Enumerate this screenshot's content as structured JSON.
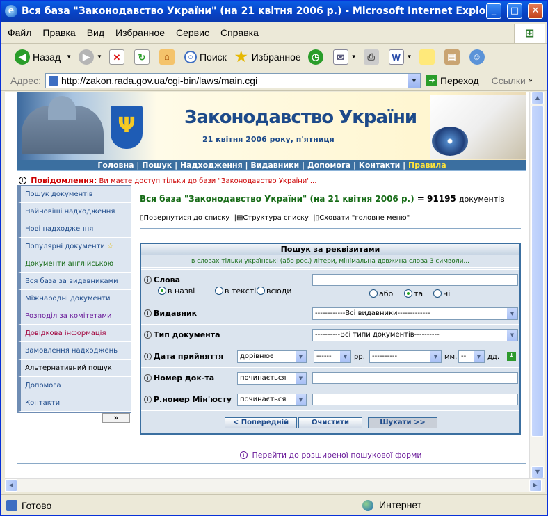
{
  "window": {
    "title": "Вся база \"Законодавство України\" (на 21 квітня 2006 р.) - Microsoft Internet Explorer"
  },
  "menu": [
    "Файл",
    "Правка",
    "Вид",
    "Избранное",
    "Сервис",
    "Справка"
  ],
  "toolbar": {
    "back": "Назад",
    "search": "Поиск",
    "favorites": "Избранное"
  },
  "address": {
    "label": "Адрес:",
    "url": "http://zakon.rada.gov.ua/cgi-bin/laws/main.cgi",
    "go": "Переход",
    "links": "Ссылки"
  },
  "banner": {
    "title": "Законодавство України",
    "date": "21 квітня 2006 року, п'ятниця"
  },
  "nav": [
    "Головна",
    "Пошук",
    "Надходження",
    "Видавники",
    "Допомога",
    "Контакти",
    "Правила"
  ],
  "message": {
    "label": "Повідомлення:",
    "text": "Ви маєте доступ тільки до бази \"Законодавство України\"..."
  },
  "sidebar": {
    "items": [
      "Пошук документів",
      "Найновіші надходження",
      "Нові надходження",
      "Популярні документи",
      "Документи англійською",
      "Вся база за видавниками",
      "Міжнародні документи",
      "Розподіл за комітетами",
      "Довідкова інформація",
      "Замовлення надходжень",
      "Альтернативний пошук",
      "Допомога",
      "Контакти"
    ],
    "more": "»"
  },
  "main": {
    "title": "Вся база \"Законодавство України\" (на 21 квітня 2006 р.)",
    "count_prefix": "=",
    "count": "91195",
    "count_suffix": "документів",
    "links": [
      "Повернутися до списку",
      "Структура списку",
      "Сховати \"головне меню\""
    ]
  },
  "form": {
    "header": "Пошук за реквізитами",
    "subheader": "в словах тільки українські (або рос.) літери, мінімальна довжина слова 3 символи...",
    "words_label": "Слова",
    "words_scope": [
      "в назві",
      "в тексті",
      "всюди"
    ],
    "words_logic": [
      "або",
      "та",
      "ні"
    ],
    "publisher_label": "Видавник",
    "publisher_value": "------------Всі видавники-------------",
    "doctype_label": "Тип документа",
    "doctype_value": "----------Всі типи документів----------",
    "date_label": "Дата прийняття",
    "date_cmp": "дорівнює",
    "date_year": "------",
    "date_year_unit": "рр.",
    "date_month": "----------",
    "date_month_unit": "мм.",
    "date_day": "--",
    "date_day_unit": "дд.",
    "num_label": "Номер док-та",
    "num_cmp": "починається",
    "regnum_label": "Р.номер Мін'юсту",
    "regnum_cmp": "починається",
    "btn_prev": "< Попередній",
    "btn_clear": "Очистити",
    "btn_search": "Шукати >>"
  },
  "advanced_link": "Перейти до розширеної пошукової форми",
  "status": {
    "text": "Готово",
    "zone": "Интернет"
  }
}
